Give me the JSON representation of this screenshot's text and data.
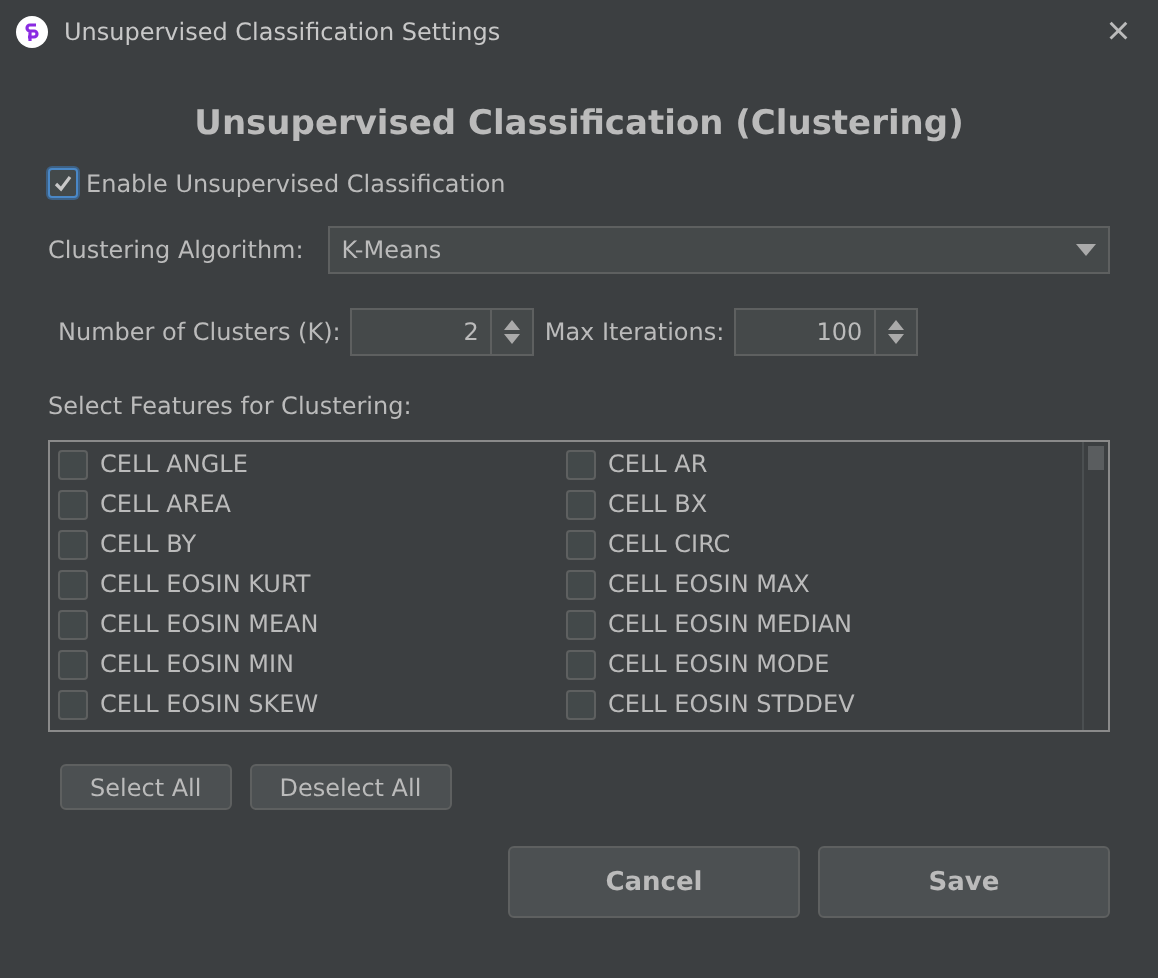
{
  "window": {
    "title": "Unsupervised Classification Settings",
    "close": "×"
  },
  "heading": "Unsupervised Classification (Clustering)",
  "enable": {
    "label": "Enable Unsupervised Classification",
    "checked": true
  },
  "algorithm": {
    "label": "Clustering Algorithm:",
    "value": "K-Means"
  },
  "clusters": {
    "label": "Number of Clusters (K):",
    "value": "2"
  },
  "iterations": {
    "label": "Max Iterations:",
    "value": "100"
  },
  "features_label": "Select Features for Clustering:",
  "features": [
    {
      "label": "CELL ANGLE",
      "checked": false
    },
    {
      "label": "CELL AR",
      "checked": false
    },
    {
      "label": "CELL AREA",
      "checked": false
    },
    {
      "label": "CELL BX",
      "checked": false
    },
    {
      "label": "CELL BY",
      "checked": false
    },
    {
      "label": "CELL CIRC",
      "checked": false
    },
    {
      "label": "CELL EOSIN KURT",
      "checked": false
    },
    {
      "label": "CELL EOSIN MAX",
      "checked": false
    },
    {
      "label": "CELL EOSIN MEAN",
      "checked": false
    },
    {
      "label": "CELL EOSIN MEDIAN",
      "checked": false
    },
    {
      "label": "CELL EOSIN MIN",
      "checked": false
    },
    {
      "label": "CELL EOSIN MODE",
      "checked": false
    },
    {
      "label": "CELL EOSIN SKEW",
      "checked": false
    },
    {
      "label": "CELL EOSIN STDDEV",
      "checked": false
    }
  ],
  "list_buttons": [
    "Select All",
    "Deselect All"
  ],
  "buttons": [
    "Cancel",
    "Save"
  ]
}
